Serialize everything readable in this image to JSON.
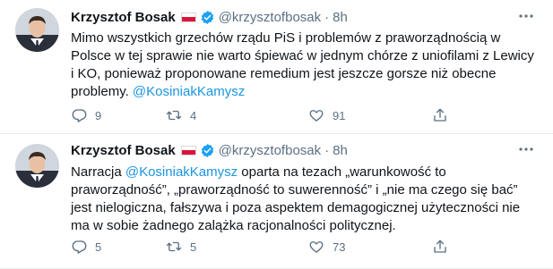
{
  "tweets": [
    {
      "author": {
        "name": "Krzysztof Bosak",
        "handle": "@krzysztofbosak"
      },
      "dot": "·",
      "time": "8h",
      "text_parts": [
        "Mimo wszystkich grzechów rządu PiS i problemów z praworządnością w Polsce w tej sprawie nie warto śpiewać w jednym chórze z uniofilami z Lewicy i KO, ponieważ proponowane remedium jest jeszcze gorsze niż obecne problemy. ",
        "@KosiniakKamysz"
      ],
      "counts": {
        "reply": "9",
        "retweet": "4",
        "like": "91"
      }
    },
    {
      "author": {
        "name": "Krzysztof Bosak",
        "handle": "@krzysztofbosak"
      },
      "dot": "·",
      "time": "8h",
      "text_parts": [
        "Narracja ",
        "@KosiniakKamysz",
        " oparta na tezach „warunkowość to praworządność”, „praworządność to suwerenność” i „nie ma czego się bać” jest nielogiczna, fałszywa i poza aspektem demagogicznej użyteczności nie ma w sobie żadnego zalążka racjonalności politycznej."
      ],
      "counts": {
        "reply": "5",
        "retweet": "5",
        "like": "73"
      }
    }
  ],
  "colors": {
    "link": "#1b95e0",
    "muted": "#5b7083",
    "verified": "#1da1f2",
    "flag_red": "#dc143c"
  },
  "icons": [
    "avatar",
    "poland-flag-icon",
    "verified-badge-icon",
    "more-options-icon",
    "reply-icon",
    "retweet-icon",
    "like-icon",
    "share-icon"
  ]
}
